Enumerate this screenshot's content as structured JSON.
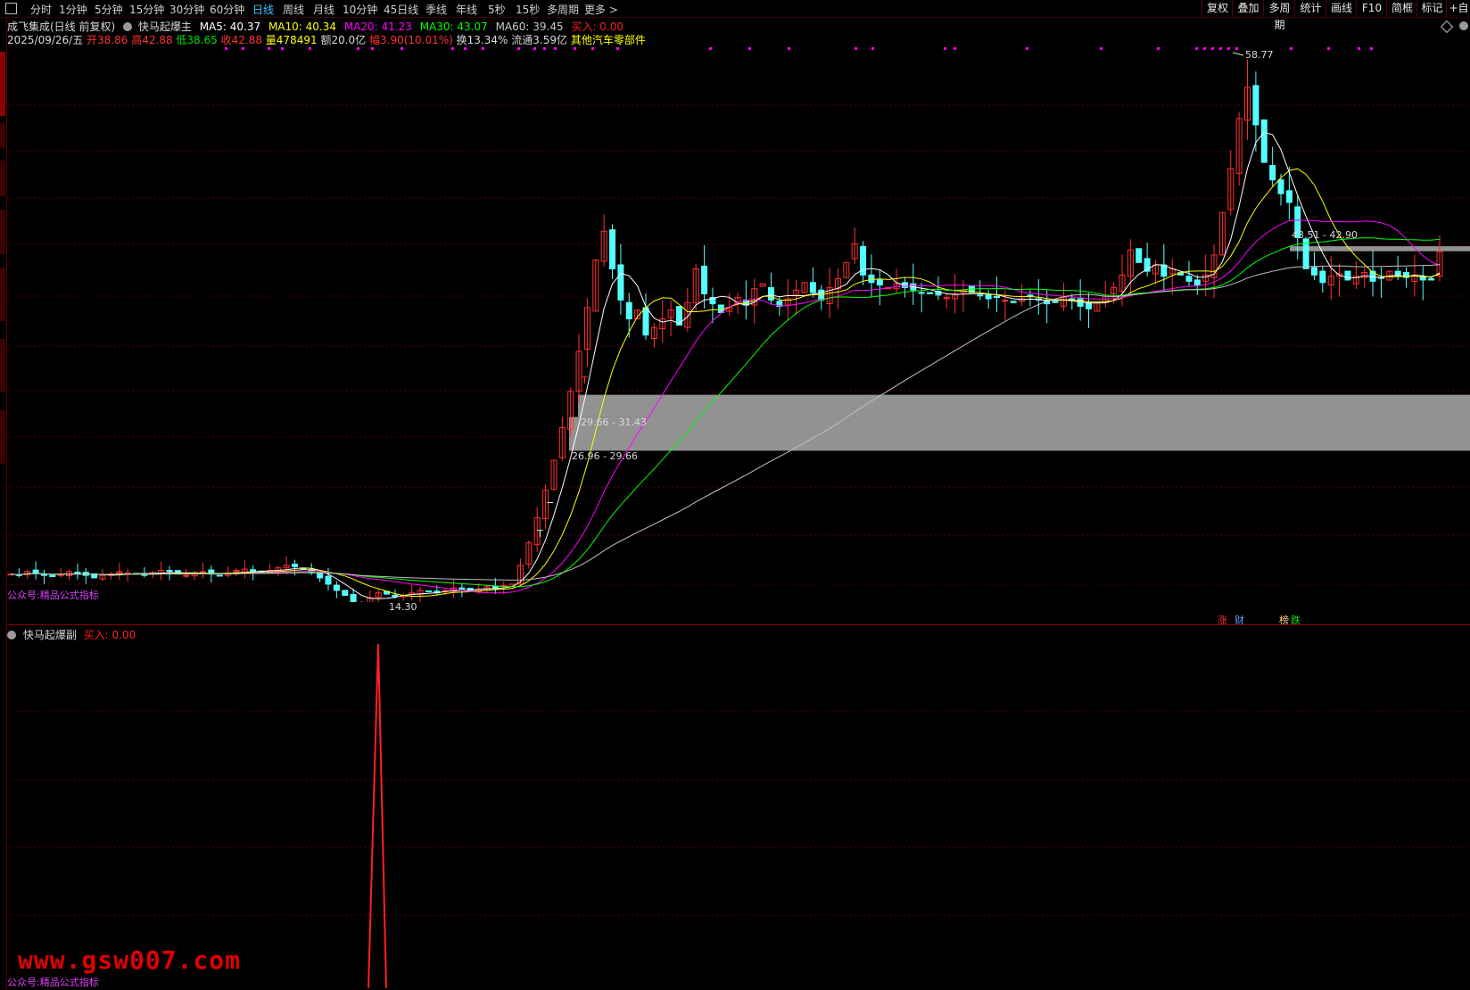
{
  "toolbar": {
    "left": [
      "分时",
      "1分钟",
      "5分钟",
      "15分钟",
      "30分钟",
      "60分钟",
      "日线",
      "周线",
      "月线",
      "10分钟",
      "45日线",
      "季线",
      "年线",
      "5秒",
      "15秒",
      "多周期",
      "更多 >"
    ],
    "active": "日线",
    "right": [
      "复权",
      "叠加",
      "多周期",
      "统计",
      "画线",
      "F10",
      "简框",
      "标记",
      "+自"
    ]
  },
  "main_header": {
    "stock": "成飞集成(日线 前复权)",
    "indicator": "快马起爆主",
    "ma5": "MA5: 40.37",
    "ma10": "MA10: 40.34",
    "ma20": "MA20: 41.23",
    "ma30": "MA30: 43.07",
    "ma60": "MA60: 39.45",
    "buy": "买入: 0.00"
  },
  "quote_line": {
    "date": "2025/09/26/五",
    "open": "开38.86",
    "high": "高42.88",
    "low": "低38.65",
    "close": "收42.88",
    "volume": "量478491",
    "amount": "额20.0亿",
    "change": "幅3.90(10.01%)",
    "turnover": "换13.34%",
    "float": "流通3.59亿",
    "sector": "其他汽车零部件"
  },
  "labels": {
    "high_price": "58.77",
    "low_price": "14.30",
    "zone_top": "43.51 - 42.90",
    "zone_mid": "29.66 - 31.43",
    "zone_low": "26.96 - 29.66",
    "t1": "T",
    "t2": "T",
    "dash": "−"
  },
  "tags": {
    "zhang": "涨",
    "cai": "财",
    "bang": "榜",
    "die": "跌"
  },
  "sub_header": {
    "indicator": "快马起爆副",
    "buy": "买入: 0.00"
  },
  "promo_main": "公众号:精品公式指标",
  "promo_sub": "公众号:精品公式指标",
  "watermark": "www.gsw007.com",
  "colors": {
    "up": "#ff3030",
    "down": "#54ffff",
    "ma5": "#ffffff",
    "ma10": "#ffff00",
    "ma20": "#ff00ff",
    "ma30": "#00ff00",
    "ma60": "#c0c0c0",
    "zone": "#9a9a9a",
    "grid": "#5a0000"
  },
  "chart_data": {
    "type": "candlestick",
    "price_extremes": {
      "high": 58.77,
      "low": 14.3
    },
    "support_zones": [
      {
        "label": "43.51 - 42.90",
        "from": 42.9,
        "to": 43.51
      },
      {
        "label": "29.66 - 31.43",
        "from": 29.66,
        "to": 31.43
      },
      {
        "label": "26.96 - 29.66",
        "from": 26.96,
        "to": 29.66
      }
    ],
    "series": [
      "MA5",
      "MA10",
      "MA20",
      "MA30",
      "MA60"
    ],
    "closes": [
      17.1,
      17.0,
      17.3,
      17.2,
      17.0,
      16.9,
      17.1,
      17.3,
      17.2,
      17.0,
      16.8,
      17.0,
      17.1,
      17.3,
      17.2,
      17.1,
      17.0,
      17.2,
      17.4,
      17.3,
      17.1,
      17.0,
      17.2,
      17.3,
      17.1,
      17.0,
      17.2,
      17.4,
      17.5,
      17.3,
      17.2,
      17.4,
      17.6,
      17.8,
      17.7,
      17.5,
      17.2,
      16.8,
      16.3,
      15.8,
      15.4,
      14.9,
      14.6,
      15.2,
      15.6,
      15.5,
      15.3,
      15.4,
      15.6,
      15.8,
      15.7,
      15.6,
      15.8,
      16.0,
      15.9,
      15.8,
      15.9,
      16.1,
      16.0,
      16.2,
      16.3,
      17.8,
      19.6,
      21.6,
      23.8,
      26.2,
      28.8,
      31.7,
      34.9,
      38.4,
      42.2,
      44.5,
      41.5,
      39.0,
      37.5,
      38.2,
      36.2,
      36.8,
      37.5,
      38.2,
      37.0,
      38.8,
      41.5,
      39.5,
      38.7,
      38.0,
      38.4,
      39.2,
      38.6,
      39.9,
      40.3,
      39.0,
      38.5,
      39.1,
      39.8,
      40.4,
      39.6,
      39.0,
      40.0,
      40.7,
      42.0,
      43.5,
      41.0,
      40.4,
      40.2,
      40.0,
      40.3,
      40.0,
      39.8,
      39.6,
      39.5,
      39.4,
      39.2,
      39.5,
      39.8,
      39.6,
      39.4,
      39.1,
      39.2,
      39.0,
      38.8,
      39.1,
      39.3,
      39.0,
      38.7,
      38.8,
      39.2,
      39.0,
      38.5,
      38.3,
      38.8,
      39.3,
      40.0,
      41.0,
      43.0,
      42.0,
      41.3,
      41.8,
      40.9,
      41.5,
      41.0,
      40.5,
      40.2,
      41.0,
      42.6,
      46.0,
      49.5,
      53.5,
      56.0,
      53.0,
      50.0,
      48.6,
      47.5,
      46.8,
      44.0,
      41.5,
      41.0,
      40.4,
      40.9,
      41.1,
      40.6,
      40.9,
      41.2,
      40.5,
      40.8,
      41.3,
      41.0,
      40.8,
      41.0,
      40.6,
      40.6,
      42.88
    ]
  }
}
